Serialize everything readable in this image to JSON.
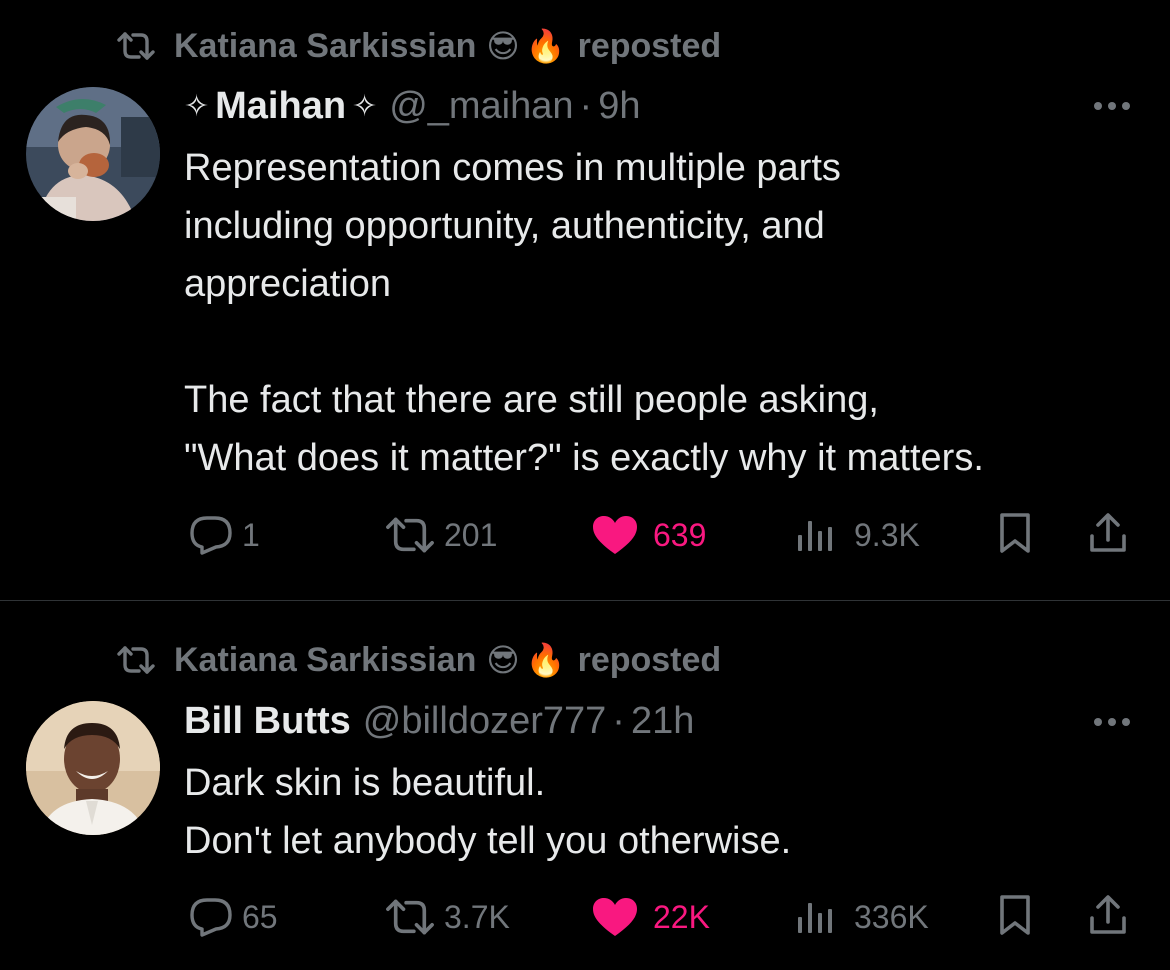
{
  "tweets": [
    {
      "reposter": {
        "name": "Katiana Sarkissian",
        "emoji1": "😎",
        "emoji2": "🔥",
        "label": "reposted"
      },
      "author": {
        "sparkle_left": "✧",
        "name": "Maihan",
        "sparkle_right": "✧",
        "handle": "@_maihan",
        "separator": "·",
        "time": "9h"
      },
      "text": "Representation comes in multiple parts\nincluding opportunity, authenticity, and\nappreciation\n\nThe fact that there are still people asking,\n\"What does it matter?\" is exactly why it matters.",
      "stats": {
        "replies": "1",
        "reposts": "201",
        "likes": "639",
        "views": "9.3K"
      }
    },
    {
      "reposter": {
        "name": "Katiana Sarkissian",
        "emoji1": "😎",
        "emoji2": "🔥",
        "label": "reposted"
      },
      "author": {
        "name": "Bill Butts",
        "handle": "@billdozer777",
        "separator": "·",
        "time": "21h"
      },
      "text": "Dark skin is beautiful.\nDon't let anybody tell you otherwise.",
      "stats": {
        "replies": "65",
        "reposts": "3.7K",
        "likes": "22K",
        "views": "336K"
      }
    }
  ],
  "colors": {
    "background": "#000000",
    "text": "#e7e9ea",
    "muted": "#71767b",
    "like": "#f91880",
    "divider": "#2f3336"
  },
  "icons": [
    "repost-icon",
    "reply-icon",
    "like-icon",
    "views-icon",
    "bookmark-icon",
    "share-icon",
    "more-icon"
  ]
}
